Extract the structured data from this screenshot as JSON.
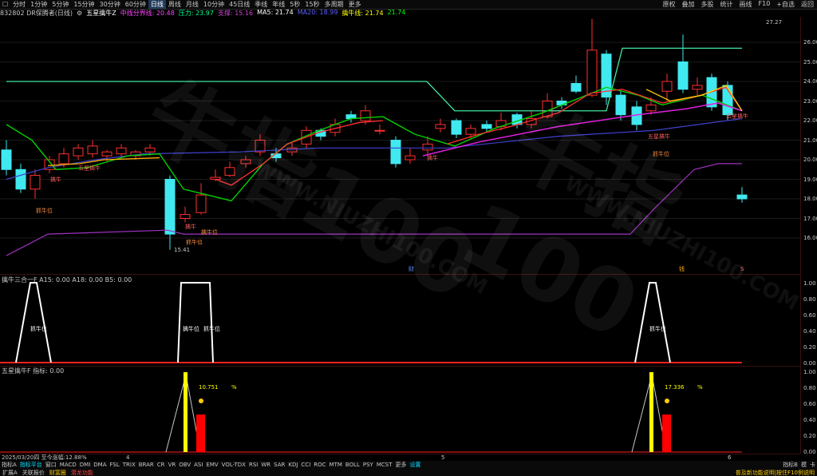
{
  "topbar": {
    "periods": [
      "分时",
      "1分钟",
      "5分钟",
      "15分钟",
      "30分钟",
      "60分钟",
      "日线",
      "周线",
      "月线",
      "10分钟",
      "45日线",
      "季线",
      "年线",
      "5秒",
      "15秒",
      "多周期",
      "更多"
    ],
    "active_period": "日线",
    "right_items": [
      "原权",
      "叠加",
      "多股",
      "统计",
      "画线",
      "F10",
      "+自选",
      "返回"
    ]
  },
  "legend": {
    "code": "832802 DR保腾者(日线)",
    "indicator": "五星擒牛Z",
    "items": [
      {
        "label": "中线分界线: 20.48",
        "color": "#ff44ff"
      },
      {
        "label": "压力: 23.97",
        "color": "#00ff90"
      },
      {
        "label": "支撑: 15.16",
        "color": "#cc44cc"
      },
      {
        "label": "MA5: 21.74",
        "color": "#ffffff"
      },
      {
        "label": "MA20: 18.99",
        "color": "#6060ff"
      },
      {
        "label": "擒牛线: 21.74",
        "color": "#ffff00"
      },
      {
        "label": "21.74",
        "color": "#00ff00"
      }
    ]
  },
  "main_chart": {
    "price_axis": [
      "26.00",
      "25.00",
      "24.00",
      "23.00",
      "22.00",
      "21.00",
      "20.00",
      "19.00",
      "18.00",
      "17.00",
      "16.00"
    ],
    "annotations": {
      "high": "27.27",
      "low": "15.41",
      "wuxing1": "五星擒牛",
      "wuxing2": "五星擒牛",
      "wuxing3": "五星擒牛",
      "qinniu1": "擒牛",
      "zhuaniu1": "抓牛位",
      "zhuaniu2": "擒牛位",
      "zhuaniu3": "抓牛位",
      "zhuaniu4": "抓牛位",
      "niu1": "擒牛",
      "niu2": "擒牛",
      "cai": "财",
      "qian": "钱",
      "marker_s": "S",
      "last_price": "27.27"
    }
  },
  "panel2": {
    "title": "擒牛三合一F A15: 0.00 A18: 0.00 B5: 0.00",
    "label1": "抓牛位",
    "label2": "擒牛位",
    "label3": "抓牛位",
    "label4": "抓牛位",
    "axis": [
      "1.00",
      "0.80",
      "0.60",
      "0.40",
      "0.20",
      "0.00"
    ]
  },
  "panel3": {
    "title": "五星擒牛F 指标: 0.00",
    "value1": "10.751",
    "pct1": "%",
    "value2": "17.336",
    "pct2": "%",
    "axis": [
      "1.00",
      "0.80",
      "0.60",
      "0.40",
      "0.20",
      "0.00"
    ]
  },
  "datebar": {
    "date": "2025/03/20四 至今涨幅:12.88%",
    "mark4": "4",
    "mark5": "5",
    "mark6": "6"
  },
  "tabs": [
    "指标A",
    "指标平台",
    "窗口",
    "MACD",
    "DMI",
    "DMA",
    "FSL",
    "TRIX",
    "BRAR",
    "CR",
    "VR",
    "OBV",
    "ASI",
    "EMV",
    "VOL-TDX",
    "RSI",
    "WR",
    "SAR",
    "KDJ",
    "CCI",
    "ROC",
    "MTM",
    "BOLL",
    "PSY",
    "MCST",
    "更多",
    "设置"
  ],
  "tabs_right": [
    "指标B",
    "模",
    "卡"
  ],
  "statusbar": {
    "left": [
      "扩展A",
      "关联报价",
      "财富圈",
      "潜龙功能"
    ],
    "right": "普及新功能说明|按住F10例说明"
  },
  "watermark": {
    "big": "牛指100",
    "url": "WWW.NIUZHI100.COM"
  },
  "colors": {
    "up": "#ff3030",
    "down": "#40e8f0",
    "bg": "#000000"
  }
}
